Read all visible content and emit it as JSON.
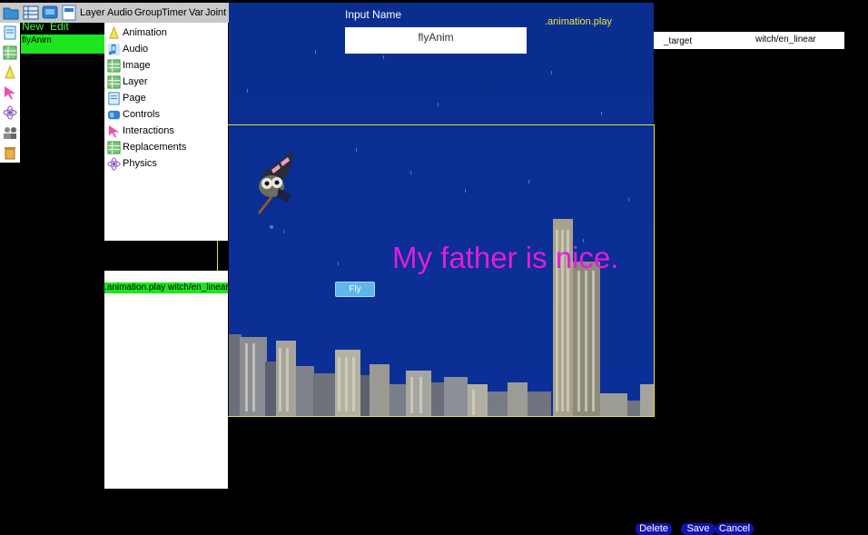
{
  "toolbar": {
    "menus": [
      "Layer",
      "Audio",
      "Group",
      "Timer",
      "Var",
      "Joint"
    ]
  },
  "left_tools": [
    "page-icon",
    "grid-icon",
    "cone-icon",
    "pointer-icon",
    "atom-icon",
    "people-icon",
    "trash-icon"
  ],
  "list": {
    "new_label": "New",
    "edit_label": "Edit",
    "selected_item": "flyAnim"
  },
  "component_menu": [
    {
      "label": "Animation",
      "icon": "cone-icon"
    },
    {
      "label": "Audio",
      "icon": "music-note-icon"
    },
    {
      "label": "Image",
      "icon": "grid-icon"
    },
    {
      "label": "Layer",
      "icon": "grid-icon"
    },
    {
      "label": "Page",
      "icon": "page-icon"
    },
    {
      "label": "Controls",
      "icon": "controls-icon"
    },
    {
      "label": "Interactions",
      "icon": "pointer-icon"
    },
    {
      "label": "Replacements",
      "icon": "grid-icon"
    },
    {
      "label": "Physics",
      "icon": "atom-icon"
    }
  ],
  "action_list": {
    "selected_action": ".animation.play witch/en_linear"
  },
  "editor": {
    "input_label": "Input Name",
    "input_value": "flyAnim",
    "event_label": ".animation.play",
    "target_key": "_target",
    "target_value": "witch/en_linear"
  },
  "stage": {
    "sentence": "My father is nice.",
    "fly_button": "Fly"
  },
  "buttons": {
    "delete": "Delete",
    "save": "Save",
    "cancel": "Cancel"
  },
  "colors": {
    "stage_bg": "#0a2b8a",
    "highlight_green": "#1ee61e",
    "sentence": "#e31be0",
    "frame": "#e8e03a",
    "button_blue": "#1212b0"
  }
}
